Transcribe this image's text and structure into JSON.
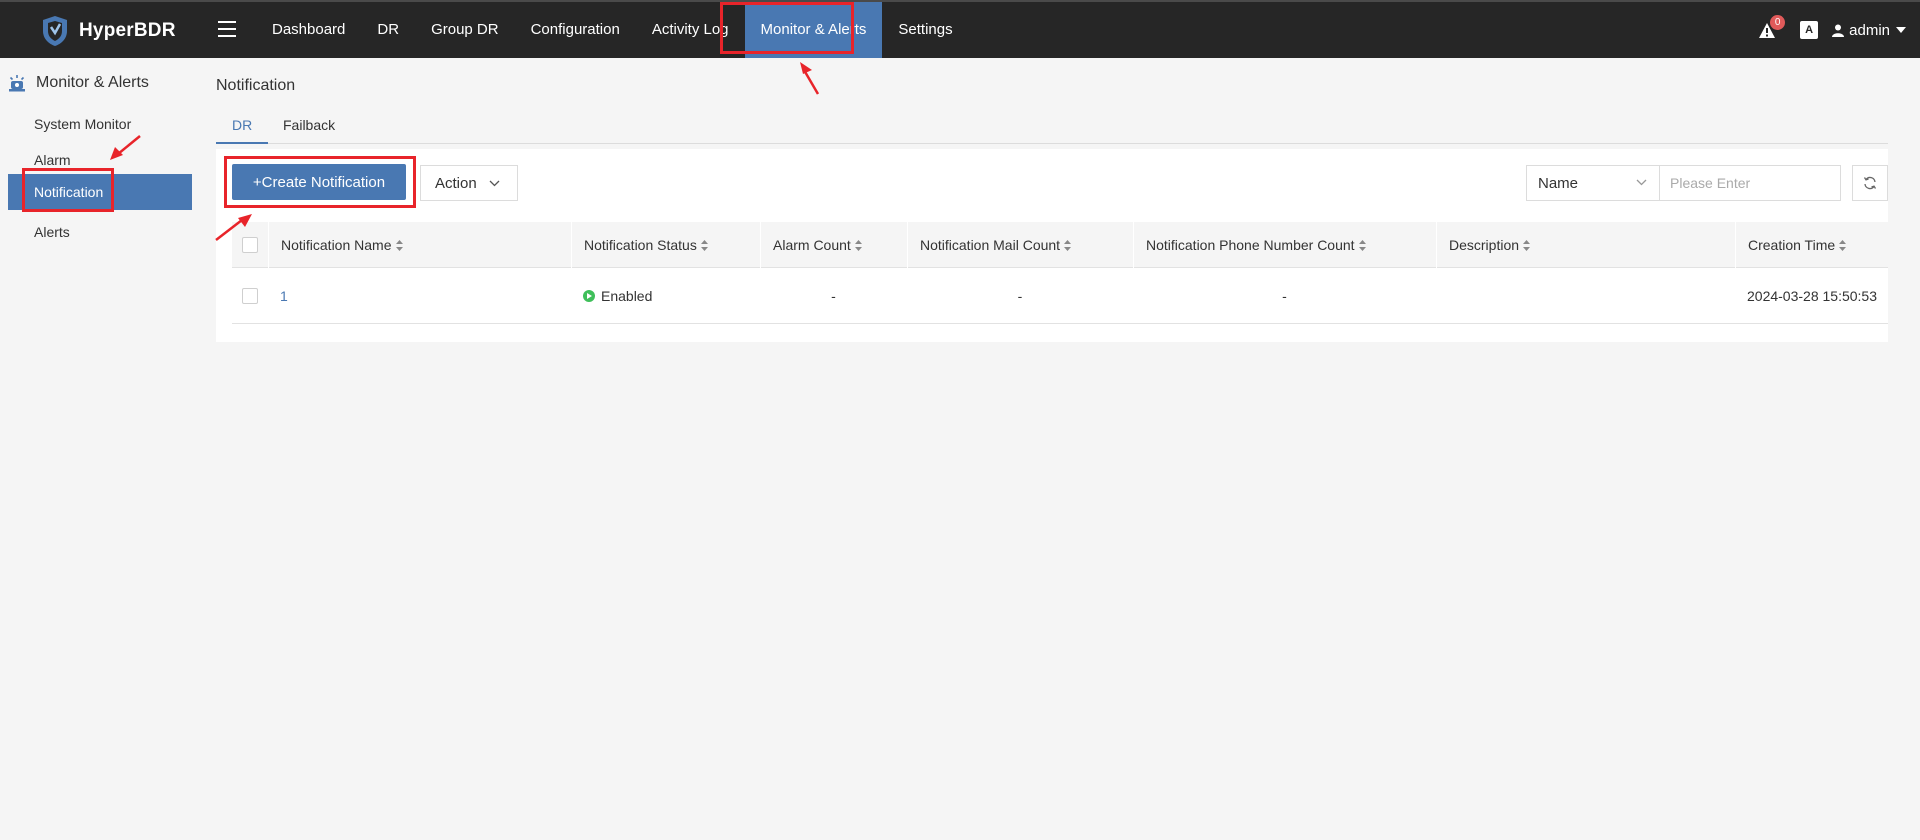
{
  "app": {
    "name": "HyperBDR"
  },
  "nav": {
    "items": [
      {
        "label": "Dashboard",
        "active": false
      },
      {
        "label": "DR",
        "active": false
      },
      {
        "label": "Group DR",
        "active": false
      },
      {
        "label": "Configuration",
        "active": false
      },
      {
        "label": "Activity Log",
        "active": false
      },
      {
        "label": "Monitor & Alerts",
        "active": true
      },
      {
        "label": "Settings",
        "active": false
      }
    ]
  },
  "topright": {
    "alarm_count": "0",
    "lang_label": "A",
    "user": "admin"
  },
  "sidebar": {
    "title": "Monitor & Alerts",
    "items": [
      {
        "label": "System Monitor",
        "active": false
      },
      {
        "label": "Alarm",
        "active": false
      },
      {
        "label": "Notification",
        "active": true
      },
      {
        "label": "Alerts",
        "active": false
      }
    ]
  },
  "page": {
    "title": "Notification"
  },
  "tabs": [
    {
      "label": "DR",
      "active": true
    },
    {
      "label": "Failback",
      "active": false
    }
  ],
  "toolbar": {
    "create_label": "+Create Notification",
    "action_label": "Action",
    "filter_select": "Name",
    "search_placeholder": "Please Enter"
  },
  "table": {
    "columns": [
      "Notification Name",
      "Notification Status",
      "Alarm Count",
      "Notification Mail Count",
      "Notification Phone Number Count",
      "Description",
      "Creation Time"
    ],
    "rows": [
      {
        "name": "1",
        "status": "Enabled",
        "alarm_count": "-",
        "mail_count": "-",
        "phone_count": "-",
        "description": "",
        "creation_time": "2024-03-28 15:50:53"
      }
    ]
  },
  "colors": {
    "primary": "#4978b2",
    "topbar": "#262626",
    "highlight": "#e8242a",
    "enabled": "#3fbf5a"
  }
}
